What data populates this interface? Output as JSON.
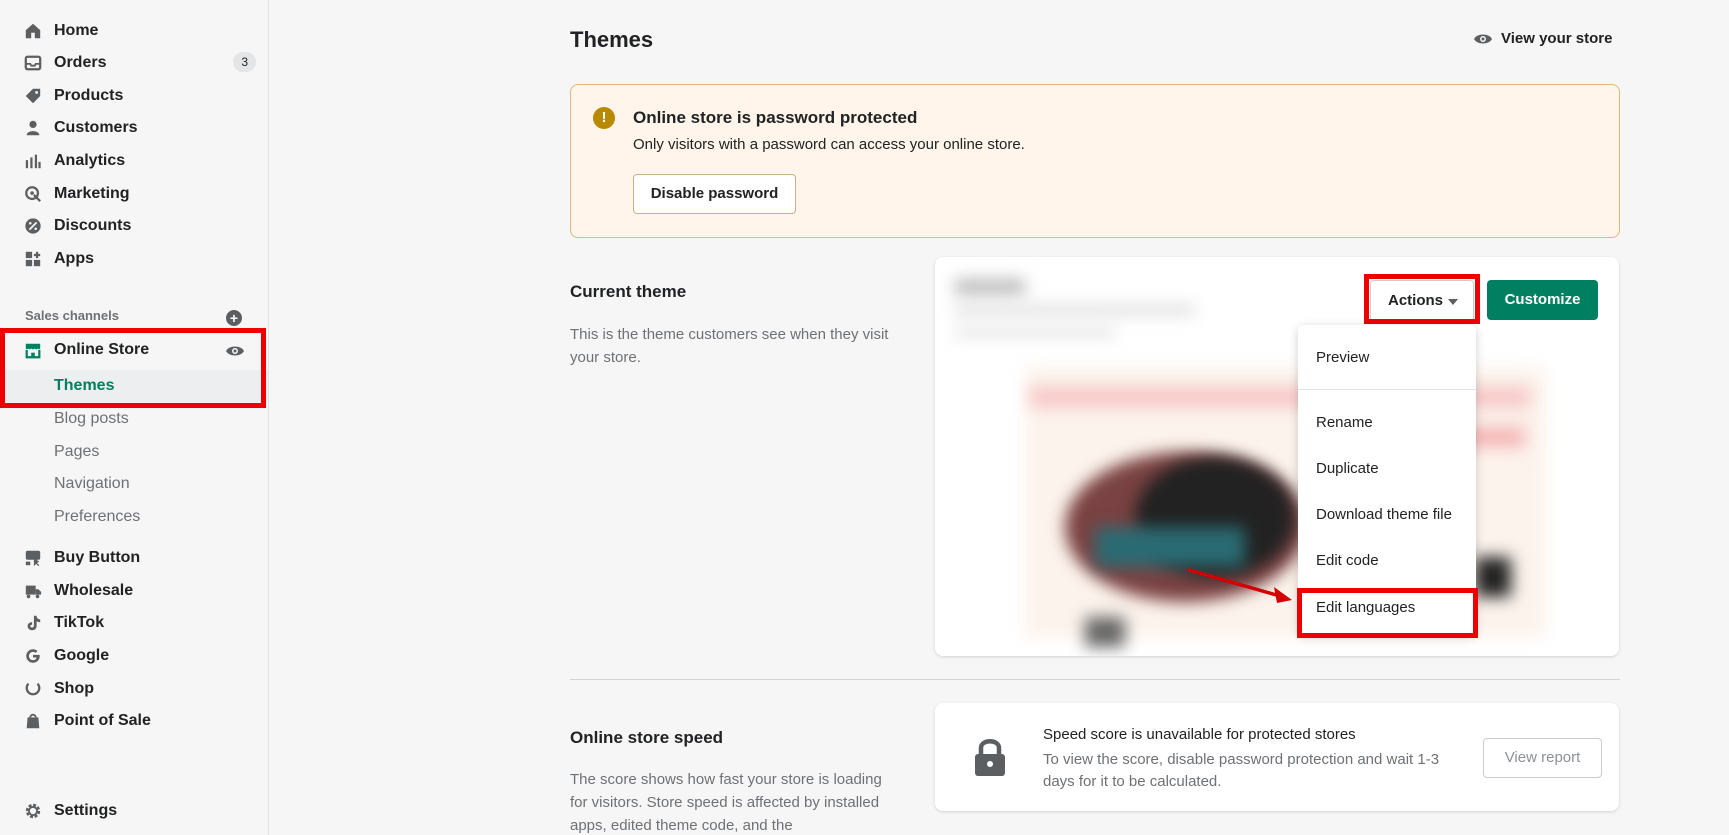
{
  "sidebar": {
    "items": [
      {
        "label": "Home",
        "icon": "home-icon"
      },
      {
        "label": "Orders",
        "icon": "orders-icon",
        "badge": "3"
      },
      {
        "label": "Products",
        "icon": "tag-icon"
      },
      {
        "label": "Customers",
        "icon": "person-icon"
      },
      {
        "label": "Analytics",
        "icon": "bar-chart-icon"
      },
      {
        "label": "Marketing",
        "icon": "marketing-icon"
      },
      {
        "label": "Discounts",
        "icon": "discount-icon"
      },
      {
        "label": "Apps",
        "icon": "apps-icon"
      }
    ],
    "sales_channels_title": "Sales channels",
    "online_store": {
      "label": "Online Store",
      "icon": "store-icon"
    },
    "online_store_sub": [
      "Themes",
      "Blog posts",
      "Pages",
      "Navigation",
      "Preferences"
    ],
    "channels": [
      {
        "label": "Buy Button",
        "icon": "buy-button-icon"
      },
      {
        "label": "Wholesale",
        "icon": "wholesale-icon"
      },
      {
        "label": "TikTok",
        "icon": "tiktok-icon"
      },
      {
        "label": "Google",
        "icon": "google-icon"
      },
      {
        "label": "Shop",
        "icon": "shop-icon"
      },
      {
        "label": "Point of Sale",
        "icon": "pos-icon"
      }
    ],
    "settings": {
      "label": "Settings",
      "icon": "gear-icon"
    }
  },
  "header": {
    "title": "Themes",
    "view_store": "View your store"
  },
  "banner": {
    "title": "Online store is password protected",
    "text": "Only visitors with a password can access your online store.",
    "button": "Disable password"
  },
  "current_theme": {
    "title": "Current theme",
    "description": "This is the theme customers see when they visit your store.",
    "actions_label": "Actions",
    "customize_label": "Customize",
    "menu": [
      "Preview",
      "Rename",
      "Duplicate",
      "Download theme file",
      "Edit code",
      "Edit languages"
    ]
  },
  "speed": {
    "title": "Online store speed",
    "description": "The score shows how fast your store is loading for visitors. Store speed is affected by installed apps, edited theme code, and the",
    "card_title": "Speed score is unavailable for protected stores",
    "card_text": "To view the score, disable password protection and wait 1-3 days for it to be calculated.",
    "report_button": "View report"
  },
  "colors": {
    "accent": "#008060",
    "highlight": "#e00000",
    "banner_bg": "#fff5ea",
    "warning": "#b98900"
  }
}
